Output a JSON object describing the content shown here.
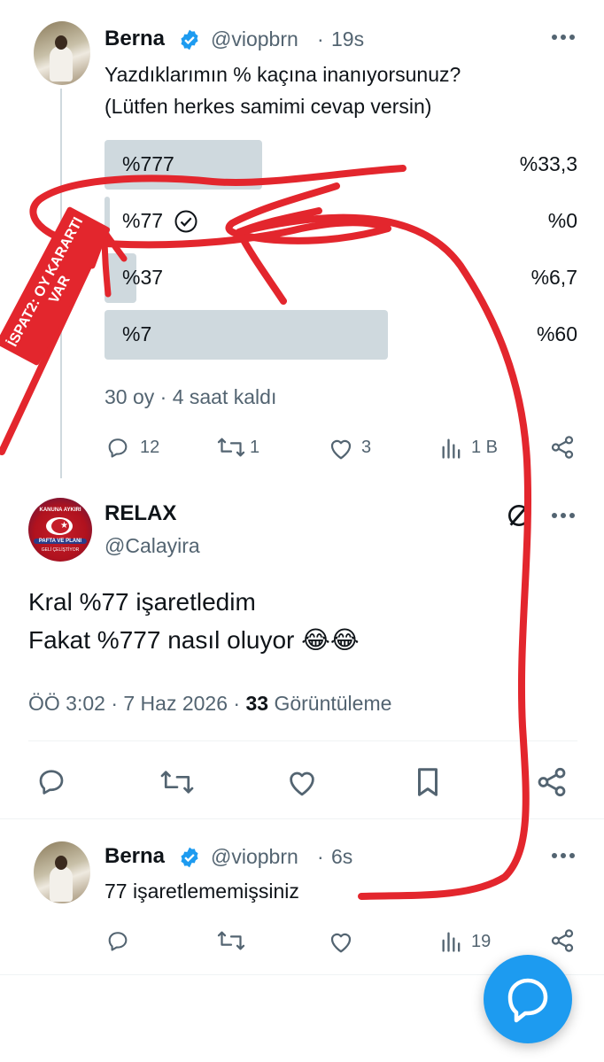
{
  "colors": {
    "accent": "#1d9bf0",
    "muted": "#536471",
    "poll_bar": "#cfd9de",
    "annotation": "#e3262d"
  },
  "tweet1": {
    "author": "Berna",
    "handle": "@viopbrn",
    "time": "19s",
    "text_line1": "Yazdıklarımın % kaçına inanıyorsunuz?",
    "text_line2": "(Lütfen herkes samimi cevap versin)",
    "poll": {
      "options": [
        {
          "label": "%777",
          "percent": "%33,3",
          "fill": 0.333,
          "selected": false
        },
        {
          "label": "%77",
          "percent": "%0",
          "fill": 0.0,
          "selected": true
        },
        {
          "label": "%37",
          "percent": "%6,7",
          "fill": 0.067,
          "selected": false
        },
        {
          "label": "%7",
          "percent": "%60",
          "fill": 0.6,
          "selected": false
        }
      ],
      "meta": "30 oy · 4 saat kaldı"
    },
    "actions": {
      "replies": "12",
      "retweets": "1",
      "likes": "3",
      "views": "1 B"
    }
  },
  "tweet2": {
    "author": "RELAX",
    "handle": "@Calayira",
    "text_line1": "Kral %77 işaretledim",
    "text_line2": "Fakat %777 nasıl oluyor 😂😂",
    "timestamp": "ÖÖ 3:02 · 7 Haz 2026 · ",
    "views_count": "33",
    "views_label": "Görüntüleme"
  },
  "tweet3": {
    "author": "Berna",
    "handle": "@viopbrn",
    "time": "6s",
    "text": "77 işaretlememişsiniz",
    "actions": {
      "views": "19"
    }
  },
  "annotation": {
    "label": "İSPAT2: OY KARARTI VAR"
  },
  "avatar_relax_text": {
    "top": "KANUNA AYKIRI",
    "middle": "PAFTA VE PLANI",
    "bottom": "GELİ ÇELİŞTİYOR"
  }
}
